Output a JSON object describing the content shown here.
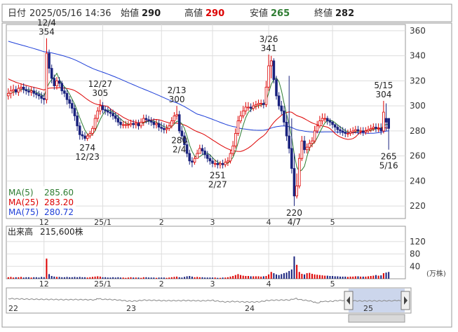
{
  "header": {
    "date_label": "日付",
    "datetime": "2025/05/16 14:36",
    "open_label": "始値",
    "open_value": "290",
    "high_label": "高値",
    "high_value": "290",
    "low_label": "安値",
    "low_value": "265",
    "close_label": "終値",
    "close_value": "282"
  },
  "legend": {
    "ma5": "MA(5)",
    "ma5_value": "285.60",
    "ma25": "MA(25)",
    "ma25_value": "283.20",
    "ma75": "MA(75)",
    "ma75_value": "280.72"
  },
  "volume_panel": {
    "label": "出来高",
    "value": "215,600株",
    "unit": "(万株)"
  },
  "overview": {
    "labels": [
      "22",
      "23",
      "24",
      "25"
    ]
  },
  "colors": {
    "up": "#dd0000",
    "down": "#1a237e",
    "ma5": "#2e7d32",
    "ma25": "#dd0000",
    "ma75": "#1e3fd8",
    "grid": "#dddddd",
    "volume_down": "#1a237e",
    "volume_up": "#dd0000"
  },
  "chart_data": [
    {
      "type": "candlestick",
      "y_axis": {
        "min": 210,
        "max": 365,
        "ticks": [
          220,
          240,
          260,
          280,
          300,
          320,
          340,
          360
        ]
      },
      "x_ticks": [
        "12",
        "25/1",
        "2",
        "3",
        "4",
        "5"
      ],
      "annotations": [
        {
          "date": "12/4",
          "value": "354",
          "kind": "high"
        },
        {
          "date": "12/27",
          "value": "305",
          "kind": "high"
        },
        {
          "date": "12/23",
          "value": "274",
          "kind": "low"
        },
        {
          "date": "2/4",
          "value": "280",
          "kind": "low"
        },
        {
          "date": "2/13",
          "value": "300",
          "kind": "high"
        },
        {
          "date": "2/27",
          "value": "251",
          "kind": "low"
        },
        {
          "date": "3/26",
          "value": "341",
          "kind": "high"
        },
        {
          "date": "4/7",
          "value": "220",
          "kind": "low"
        },
        {
          "date": "5/15",
          "value": "304",
          "kind": "high"
        },
        {
          "date": "5/16",
          "value": "265",
          "kind": "low"
        }
      ],
      "series": [
        {
          "name": "MA(5)",
          "last": 285.6
        },
        {
          "name": "MA(25)",
          "last": 283.2
        },
        {
          "name": "MA(75)",
          "last": 280.72
        }
      ],
      "ma75_before": [
        356,
        355,
        354,
        353,
        352,
        351.5,
        351,
        350,
        349,
        348
      ],
      "ma25_before": [
        336,
        335,
        333,
        331,
        330,
        328,
        326,
        325,
        324,
        323,
        322,
        321,
        320,
        319,
        318,
        318,
        317,
        317,
        316,
        316,
        315,
        314,
        313,
        312
      ],
      "close": [
        310,
        312,
        313,
        311,
        314,
        315,
        313,
        312,
        311,
        312,
        310,
        309,
        308,
        306,
        305,
        342,
        330,
        322,
        316,
        320,
        318,
        312,
        310,
        305,
        302,
        298,
        292,
        284,
        277,
        276,
        274,
        276,
        278,
        282,
        290,
        296,
        300,
        297,
        296,
        295,
        294,
        292,
        290,
        287,
        285,
        285,
        285,
        285,
        286,
        285,
        286,
        284,
        287,
        290,
        289,
        288,
        287,
        285,
        286,
        283,
        282,
        281,
        282,
        284,
        288,
        292,
        293,
        280,
        276,
        269,
        262,
        256,
        255,
        258,
        262,
        266,
        264,
        261,
        258,
        256,
        254,
        254,
        253,
        254,
        253,
        255,
        256,
        262,
        268,
        278,
        288,
        292,
        296,
        299,
        299,
        298,
        300,
        301,
        302,
        302,
        301,
        315,
        332,
        336,
        321,
        308,
        300,
        296,
        287,
        276,
        266,
        250,
        228,
        236,
        258,
        272,
        265,
        267,
        270,
        272,
        280,
        284,
        288,
        290,
        290,
        288,
        287,
        285,
        283,
        281,
        280,
        279,
        278,
        278,
        279,
        280,
        281,
        280,
        280,
        279,
        280,
        281,
        282,
        283,
        282,
        282,
        280,
        295,
        287,
        282
      ],
      "open": [
        308,
        310,
        312,
        313,
        311,
        314,
        315,
        313,
        312,
        311,
        312,
        310,
        309,
        308,
        306,
        305,
        342,
        330,
        322,
        316,
        320,
        318,
        312,
        310,
        305,
        302,
        298,
        292,
        284,
        277,
        276,
        274,
        276,
        278,
        282,
        290,
        296,
        300,
        297,
        296,
        295,
        294,
        292,
        290,
        287,
        285,
        285,
        285,
        285,
        286,
        285,
        286,
        284,
        287,
        290,
        289,
        288,
        287,
        285,
        286,
        283,
        282,
        281,
        282,
        284,
        288,
        292,
        293,
        280,
        276,
        269,
        262,
        256,
        255,
        258,
        262,
        266,
        264,
        261,
        258,
        256,
        254,
        254,
        253,
        254,
        253,
        255,
        256,
        262,
        268,
        278,
        288,
        292,
        296,
        299,
        299,
        298,
        300,
        301,
        302,
        302,
        301,
        315,
        332,
        336,
        321,
        308,
        300,
        296,
        287,
        276,
        266,
        250,
        228,
        236,
        258,
        272,
        265,
        267,
        270,
        272,
        280,
        284,
        288,
        290,
        290,
        288,
        287,
        285,
        283,
        281,
        280,
        279,
        278,
        278,
        279,
        280,
        281,
        280,
        280,
        279,
        280,
        281,
        282,
        283,
        282,
        282,
        280,
        290,
        290
      ],
      "high": [
        314,
        316,
        317,
        316,
        317,
        318,
        318,
        316,
        315,
        315,
        315,
        313,
        312,
        311,
        310,
        354,
        345,
        333,
        325,
        323,
        323,
        320,
        315,
        313,
        308,
        305,
        301,
        295,
        287,
        280,
        279,
        278,
        280,
        284,
        293,
        299,
        305,
        303,
        300,
        299,
        298,
        297,
        295,
        293,
        290,
        288,
        288,
        288,
        289,
        289,
        289,
        289,
        290,
        293,
        293,
        292,
        291,
        290,
        289,
        289,
        287,
        286,
        285,
        286,
        291,
        295,
        300,
        296,
        284,
        279,
        272,
        265,
        259,
        260,
        265,
        269,
        269,
        267,
        264,
        261,
        259,
        257,
        257,
        256,
        257,
        258,
        259,
        265,
        272,
        282,
        292,
        296,
        300,
        303,
        303,
        302,
        303,
        304,
        305,
        305,
        305,
        320,
        341,
        340,
        338,
        324,
        311,
        304,
        300,
        293,
        324,
        290,
        262,
        246,
        262,
        276,
        276,
        270,
        273,
        275,
        284,
        288,
        292,
        294,
        294,
        292,
        290,
        288,
        286,
        285,
        284,
        283,
        282,
        281,
        282,
        283,
        284,
        284,
        283,
        283,
        283,
        284,
        285,
        286,
        286,
        286,
        286,
        304,
        302,
        290
      ],
      "low": [
        305,
        306,
        308,
        309,
        308,
        311,
        310,
        309,
        308,
        308,
        307,
        306,
        305,
        302,
        301,
        302,
        326,
        318,
        313,
        313,
        315,
        309,
        307,
        301,
        298,
        294,
        288,
        280,
        273,
        273,
        272,
        272,
        274,
        276,
        280,
        287,
        293,
        294,
        293,
        292,
        291,
        289,
        287,
        284,
        282,
        282,
        282,
        282,
        283,
        282,
        282,
        281,
        282,
        284,
        286,
        285,
        284,
        282,
        282,
        280,
        279,
        278,
        278,
        280,
        282,
        286,
        289,
        278,
        273,
        266,
        259,
        253,
        251,
        253,
        259,
        262,
        261,
        258,
        255,
        253,
        251,
        251,
        250,
        250,
        250,
        251,
        252,
        254,
        260,
        266,
        276,
        286,
        290,
        293,
        296,
        295,
        296,
        297,
        298,
        299,
        298,
        299,
        312,
        322,
        318,
        305,
        297,
        293,
        284,
        272,
        262,
        246,
        220,
        226,
        234,
        256,
        262,
        262,
        264,
        267,
        270,
        278,
        282,
        285,
        287,
        285,
        284,
        282,
        280,
        278,
        277,
        276,
        275,
        275,
        276,
        277,
        278,
        277,
        277,
        276,
        277,
        278,
        279,
        280,
        279,
        279,
        277,
        278,
        280,
        265
      ]
    },
    {
      "type": "bar",
      "name": "volume",
      "y_axis": {
        "min": 0,
        "max": 140,
        "ticks": [
          40,
          80,
          120
        ]
      },
      "x_ticks": [
        "12",
        "25/1",
        "2",
        "3",
        "4",
        "5"
      ],
      "values": [
        5,
        6,
        4,
        5,
        5,
        6,
        4,
        5,
        5,
        4,
        5,
        5,
        4,
        6,
        5,
        65,
        15,
        9,
        7,
        6,
        6,
        5,
        5,
        6,
        5,
        5,
        6,
        5,
        6,
        5,
        5,
        4,
        5,
        6,
        7,
        8,
        7,
        5,
        5,
        4,
        4,
        5,
        4,
        5,
        4,
        4,
        3,
        4,
        5,
        4,
        4,
        4,
        3,
        5,
        5,
        4,
        4,
        4,
        3,
        4,
        4,
        4,
        3,
        4,
        5,
        6,
        7,
        5,
        4,
        6,
        8,
        9,
        7,
        5,
        6,
        5,
        5,
        4,
        4,
        4,
        4,
        4,
        3,
        3,
        4,
        4,
        5,
        7,
        9,
        12,
        15,
        12,
        10,
        9,
        9,
        8,
        8,
        8,
        8,
        7,
        8,
        9,
        14,
        22,
        18,
        14,
        12,
        15,
        18,
        20,
        25,
        30,
        72,
        45,
        22,
        16,
        14,
        18,
        19,
        16,
        14,
        13,
        12,
        11,
        10,
        10,
        9,
        9,
        8,
        8,
        7,
        7,
        7,
        6,
        7,
        7,
        8,
        8,
        7,
        7,
        7,
        8,
        9,
        10,
        12,
        10,
        11,
        18,
        20,
        22
      ],
      "label": "出来高",
      "last": "215,600株"
    }
  ]
}
